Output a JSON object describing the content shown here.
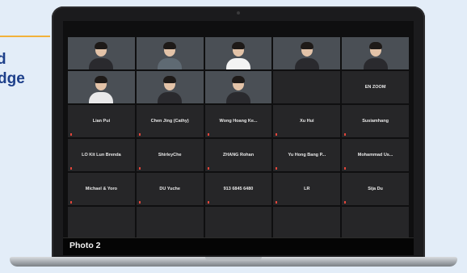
{
  "side_text": {
    "line1": "d",
    "line2": "dge"
  },
  "caption": "Photo 2",
  "tiles": [
    {
      "type": "video",
      "name": "",
      "tag": ""
    },
    {
      "type": "video",
      "name": "",
      "tag": ""
    },
    {
      "type": "video",
      "name": "",
      "tag": ""
    },
    {
      "type": "video",
      "name": "",
      "tag": ""
    },
    {
      "type": "video",
      "name": "",
      "tag": ""
    },
    {
      "type": "video",
      "name": "",
      "tag": ""
    },
    {
      "type": "video",
      "name": "",
      "tag": ""
    },
    {
      "type": "video",
      "name": "",
      "tag": ""
    },
    {
      "type": "blank",
      "name": "",
      "tag": ""
    },
    {
      "type": "blank",
      "name": "EN ZOOM",
      "tag": ""
    },
    {
      "type": "blank",
      "name": "Lian Pui",
      "tag": ""
    },
    {
      "type": "blank",
      "name": "Chen Jing (Cathy)",
      "tag": ""
    },
    {
      "type": "blank",
      "name": "Wong Hoang Ke...",
      "tag": ""
    },
    {
      "type": "blank",
      "name": "Xu Hui",
      "tag": ""
    },
    {
      "type": "blank",
      "name": "Susiamhang",
      "tag": ""
    },
    {
      "type": "blank",
      "name": "LO Kit Lun Brenda",
      "tag": ""
    },
    {
      "type": "blank",
      "name": "ShirleyChe",
      "tag": ""
    },
    {
      "type": "blank",
      "name": "ZHANG Rohan",
      "tag": ""
    },
    {
      "type": "blank",
      "name": "Yu Hong Bang P...",
      "tag": ""
    },
    {
      "type": "blank",
      "name": "Mohammad Us...",
      "tag": ""
    },
    {
      "type": "blank",
      "name": "Michael & Yoro",
      "tag": ""
    },
    {
      "type": "blank",
      "name": "DU Yuche",
      "tag": ""
    },
    {
      "type": "blank",
      "name": "913 6845 6480",
      "tag": ""
    },
    {
      "type": "blank",
      "name": "LR",
      "tag": ""
    },
    {
      "type": "blank",
      "name": "Sija Du",
      "tag": ""
    }
  ]
}
